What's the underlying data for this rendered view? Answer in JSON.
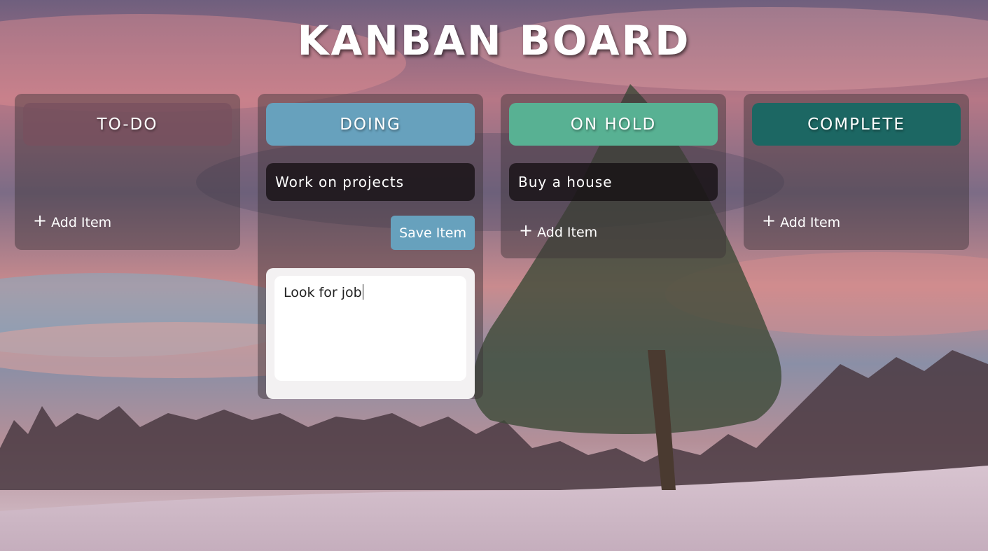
{
  "app": {
    "title": "KANBAN BOARD"
  },
  "columns": [
    {
      "id": "todo",
      "header": "TO-DO",
      "color": "#6b4b55",
      "items": [],
      "add_label": "Add Item"
    },
    {
      "id": "doing",
      "header": "DOING",
      "color": "#67a1bd",
      "items": [
        "Work on projects"
      ],
      "save_label": "Save Item",
      "new_item_value": "Look for job"
    },
    {
      "id": "on-hold",
      "header": "ON HOLD",
      "color": "#58b193",
      "items": [
        "Buy a house"
      ],
      "add_label": "Add Item"
    },
    {
      "id": "complete",
      "header": "COMPLETE",
      "color": "#1c6763",
      "items": [],
      "add_label": "Add Item"
    }
  ],
  "icons": {
    "add": "plus-icon"
  }
}
